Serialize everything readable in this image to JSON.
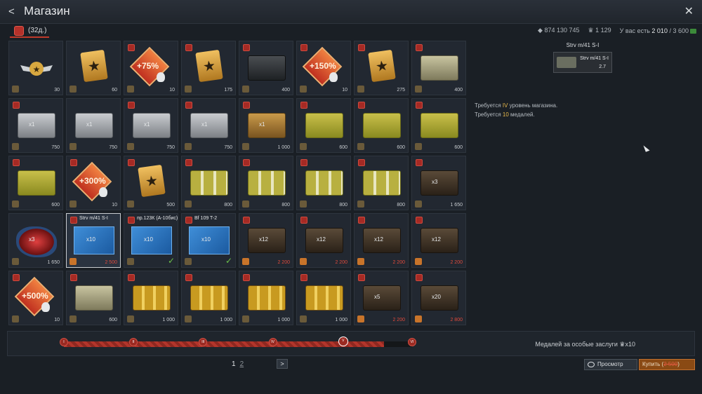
{
  "header": {
    "back_label": "<",
    "title": "Магазин",
    "close_label": "✕"
  },
  "tab": {
    "label": "(32д.)"
  },
  "currency": {
    "silver": "874 130 745",
    "gold": "1 129",
    "have_label": "У вас есть",
    "have_value": "2 010",
    "need": "/ 3 600"
  },
  "grid": [
    {
      "price": "30",
      "kind": "wings"
    },
    {
      "price": "60",
      "kind": "card"
    },
    {
      "price": "10",
      "kind": "booster",
      "text": "+75%",
      "rank": true
    },
    {
      "price": "175",
      "kind": "card",
      "rank": true
    },
    {
      "price": "400",
      "kind": "steel",
      "rank": true
    },
    {
      "price": "10",
      "kind": "booster",
      "text": "+150%",
      "rank": true
    },
    {
      "price": "275",
      "kind": "card",
      "rank": true
    },
    {
      "price": "400",
      "kind": "khaki",
      "rank": true
    },
    {
      "price": "750",
      "kind": "silver",
      "qty": "x1",
      "rank": true
    },
    {
      "price": "750",
      "kind": "silver",
      "qty": "x1"
    },
    {
      "price": "750",
      "kind": "silver",
      "qty": "x1",
      "rank": true
    },
    {
      "price": "750",
      "kind": "silver",
      "qty": "x1",
      "rank": true
    },
    {
      "price": "1 000",
      "kind": "wood",
      "qty": "x1",
      "rank": true
    },
    {
      "price": "600",
      "kind": "gold",
      "rank": true
    },
    {
      "price": "600",
      "kind": "gold",
      "rank": true
    },
    {
      "price": "600",
      "kind": "gold",
      "rank": true
    },
    {
      "price": "600",
      "kind": "gold",
      "rank": true
    },
    {
      "price": "10",
      "kind": "booster",
      "text": "+300%",
      "rank": true
    },
    {
      "price": "500",
      "kind": "card",
      "rank": true
    },
    {
      "price": "800",
      "kind": "stripe",
      "rank": true
    },
    {
      "price": "800",
      "kind": "stripe",
      "rank": true
    },
    {
      "price": "800",
      "kind": "stripe",
      "rank": true
    },
    {
      "price": "800",
      "kind": "stripe",
      "rank": true
    },
    {
      "price": "1 650",
      "kind": "dark",
      "qty": "x3",
      "rank": true
    },
    {
      "price": "1 650",
      "kind": "decal",
      "qty": "x3"
    },
    {
      "price": "2 500",
      "kind": "blueprint",
      "qty": "x10",
      "name": "Strv m/41 S-I",
      "red": true,
      "sel": true,
      "rank": true
    },
    {
      "price": "",
      "kind": "blueprint",
      "qty": "x10",
      "name": "пр.123К (А-10бис)",
      "check": true,
      "rank": true
    },
    {
      "price": "",
      "kind": "blueprint",
      "qty": "x10",
      "name": "Bf 109 T-2",
      "check": true,
      "rank": true
    },
    {
      "price": "2 200",
      "kind": "dark",
      "qty": "x12",
      "red": true,
      "rank": true
    },
    {
      "price": "2 200",
      "kind": "dark",
      "qty": "x12",
      "red": true,
      "rank": true
    },
    {
      "price": "2 200",
      "kind": "dark",
      "qty": "x12",
      "red": true,
      "rank": true
    },
    {
      "price": "2 200",
      "kind": "dark",
      "qty": "x12",
      "red": true,
      "rank": true
    },
    {
      "price": "10",
      "kind": "booster",
      "text": "+500%",
      "rank": true
    },
    {
      "price": "600",
      "kind": "khaki",
      "rank": true
    },
    {
      "price": "1 000",
      "kind": "goldstripe",
      "rank": true
    },
    {
      "price": "1 000",
      "kind": "goldstripe",
      "rank": true
    },
    {
      "price": "1 000",
      "kind": "goldstripe",
      "rank": true
    },
    {
      "price": "1 000",
      "kind": "goldstripe",
      "rank": true
    },
    {
      "price": "2 200",
      "kind": "dark",
      "qty": "x5",
      "red": true,
      "rank": true
    },
    {
      "price": "2 800",
      "kind": "dark",
      "qty": "x20",
      "red": true,
      "rank": true
    }
  ],
  "panel": {
    "title": "Strv m/41 S-I",
    "vehicle_name": "Strv m/41 S-I",
    "vehicle_br": "2.7",
    "req1_pre": "Требуется ",
    "req1_hl": "IV",
    "req1_post": " уровень магазина.",
    "req2_pre": "Требуется ",
    "req2_hl": "10",
    "req2_post": " медалей."
  },
  "progress": {
    "ticks": [
      "I",
      "II",
      "III",
      "IV",
      "V",
      "VI"
    ],
    "fill_fraction": 0.92,
    "medals_label": "Медалей за особые заслуги",
    "medals_qty": "x10"
  },
  "pagination": {
    "page1": "1",
    "page2": "2",
    "next": ">"
  },
  "actions": {
    "view_label": "Просмотр",
    "buy_label": "Купить (",
    "buy_price": "2 500",
    "buy_close": ")"
  }
}
